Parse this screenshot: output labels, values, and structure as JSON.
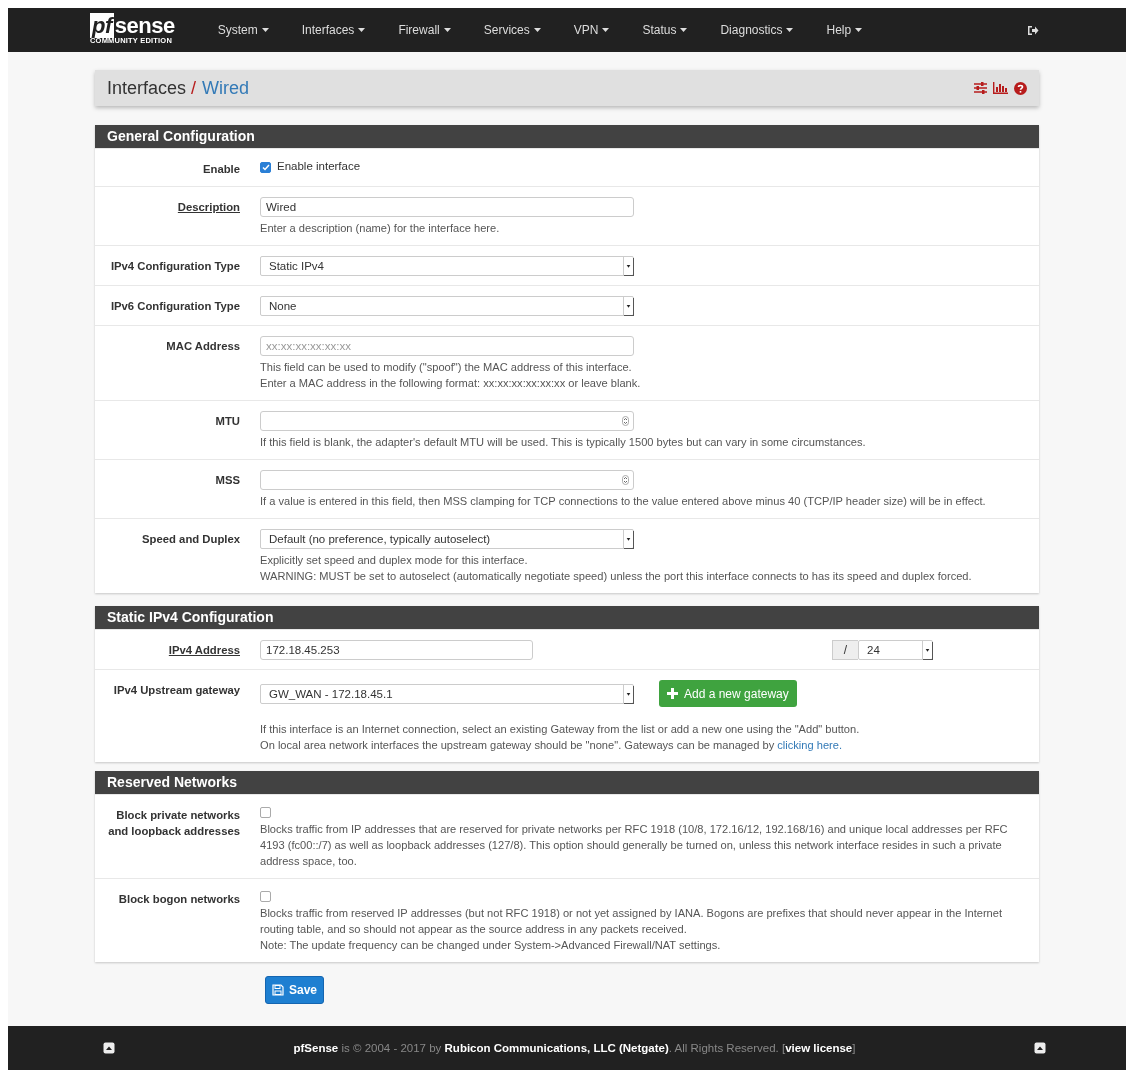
{
  "navbar": {
    "logo": {
      "mark": "pf",
      "word": "sense",
      "tagline": "COMMUNITY EDITION"
    },
    "menu": [
      "System",
      "Interfaces",
      "Firewall",
      "Services",
      "VPN",
      "Status",
      "Diagnostics",
      "Help"
    ]
  },
  "breadcrumb": {
    "parent": "Interfaces",
    "separator": "/",
    "current": "Wired"
  },
  "sections": [
    {
      "title": "General Configuration",
      "rows": [
        {
          "kind": "checkbox",
          "label": "Enable",
          "checked": true,
          "text": "Enable interface"
        },
        {
          "kind": "text",
          "label": "Description",
          "underlined": true,
          "value": "Wired",
          "help": [
            {
              "text": "Enter a description (name) for the interface here."
            }
          ]
        },
        {
          "kind": "select",
          "label": "IPv4 Configuration Type",
          "value": "Static IPv4"
        },
        {
          "kind": "select",
          "label": "IPv6 Configuration Type",
          "value": "None"
        },
        {
          "kind": "text",
          "label": "MAC Address",
          "placeholder": "xx:xx:xx:xx:xx:xx",
          "help": [
            {
              "text": "This field can be used to modify (\"spoof\") the MAC address of this interface."
            },
            {
              "text": "Enter a MAC address in the following format: xx:xx:xx:xx:xx:xx or leave blank."
            }
          ]
        },
        {
          "kind": "number",
          "label": "MTU",
          "help": [
            {
              "text": "If this field is blank, the adapter's default MTU will be used. This is typically 1500 bytes but can vary in some circumstances."
            }
          ]
        },
        {
          "kind": "number",
          "label": "MSS",
          "help": [
            {
              "text": "If a value is entered in this field, then MSS clamping for TCP connections to the value entered above minus 40 (TCP/IP header size) will be in effect."
            }
          ]
        },
        {
          "kind": "select",
          "label": "Speed and Duplex",
          "value": "Default (no preference, typically autoselect)",
          "help": [
            {
              "text": "Explicitly set speed and duplex mode for this interface."
            },
            {
              "text": "WARNING: MUST be set to autoselect (automatically negotiate speed) unless the port this interface connects to has its speed and duplex forced."
            }
          ]
        }
      ]
    },
    {
      "title": "Static IPv4 Configuration",
      "rows": [
        {
          "kind": "address",
          "label": "IPv4 Address",
          "underlined": true,
          "value": "172.18.45.253",
          "slash": "/",
          "mask": "24"
        },
        {
          "kind": "gateway",
          "label": "IPv4 Upstream gateway",
          "value": "GW_WAN - 172.18.45.1",
          "button": "Add a new gateway",
          "help": [
            {
              "text": "If this interface is an Internet connection, select an existing Gateway from the list or add a new one using the \"Add\" button."
            },
            {
              "text": "On local area network interfaces the upstream gateway should be \"none\". Gateways can be managed by ",
              "link": "clicking here."
            }
          ]
        }
      ]
    },
    {
      "title": "Reserved Networks",
      "rows": [
        {
          "kind": "checkbox",
          "label": "Block private networks and loopback addresses",
          "checked": false,
          "help": [
            {
              "text": "Blocks traffic from IP addresses that are reserved for private networks per RFC 1918 (10/8, 172.16/12, 192.168/16) and unique local addresses per RFC 4193 (fc00::/7) as well as loopback addresses (127/8). This option should generally be turned on, unless this network interface resides in such a private address space, too."
            }
          ]
        },
        {
          "kind": "checkbox",
          "label": "Block bogon networks",
          "checked": false,
          "help": [
            {
              "text": "Blocks traffic from reserved IP addresses (but not RFC 1918) or not yet assigned by IANA. Bogons are prefixes that should never appear in the Internet routing table, and so should not appear as the source address in any packets received."
            },
            {
              "text": "Note: The update frequency can be changed under System->Advanced Firewall/NAT settings."
            }
          ]
        }
      ]
    }
  ],
  "save_button": "Save",
  "footer": {
    "text": "**pfSense** is © 2004 - 2017 by **Rubicon Communications, LLC (Netgate)**. All Rights Reserved. [",
    "link": "view license",
    "after": "]"
  }
}
